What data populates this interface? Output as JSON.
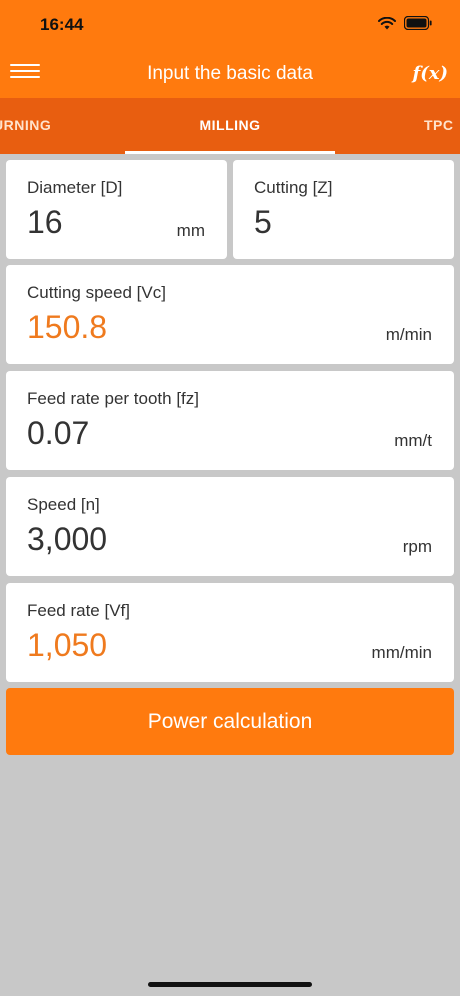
{
  "status_bar": {
    "time": "16:44"
  },
  "header": {
    "title": "Input the basic data",
    "fx_label": "f(x)"
  },
  "tabs": [
    {
      "label": "URNING"
    },
    {
      "label": "MILLING"
    },
    {
      "label": "TPC"
    }
  ],
  "fields": {
    "diameter": {
      "label": "Diameter [D]",
      "value": "16",
      "unit": "mm"
    },
    "cutting": {
      "label": "Cutting [Z]",
      "value": "5"
    },
    "cutting_speed": {
      "label": "Cutting speed [Vc]",
      "value": "150.8",
      "unit": "m/min"
    },
    "feed_per_tooth": {
      "label": "Feed rate per tooth [fz]",
      "value": "0.07",
      "unit": "mm/t"
    },
    "speed": {
      "label": "Speed [n]",
      "value": "3,000",
      "unit": "rpm"
    },
    "feed_rate": {
      "label": "Feed rate [Vf]",
      "value": "1,050",
      "unit": "mm/min"
    }
  },
  "actions": {
    "power_calculation": "Power calculation"
  },
  "colors": {
    "accent": "#ff7a0e",
    "tab_bar": "#e85e10",
    "computed_value": "#ef7a1e",
    "background": "#c8c8c8"
  }
}
